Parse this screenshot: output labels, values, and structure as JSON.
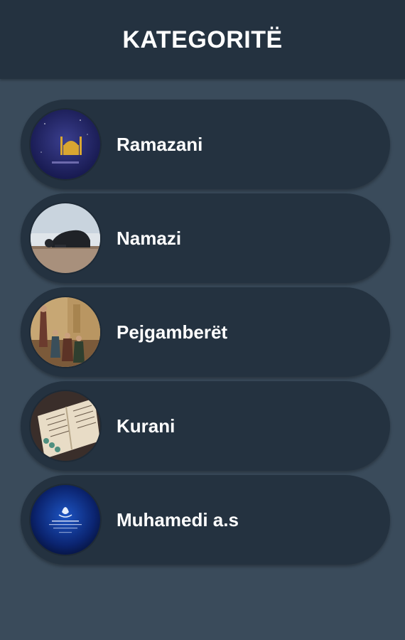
{
  "header": {
    "title": "KATEGORITË"
  },
  "categories": [
    {
      "label": "Ramazani",
      "image": "mosque-crescent-image"
    },
    {
      "label": "Namazi",
      "image": "prayer-prostration-image"
    },
    {
      "label": "Pejgamberët",
      "image": "prophets-painting-image"
    },
    {
      "label": "Kurani",
      "image": "quran-book-image"
    },
    {
      "label": "Muhamedi a.s",
      "image": "calligraphy-emblem-image"
    }
  ],
  "colors": {
    "background": "#3a4b5b",
    "header": "#243240",
    "card": "#243240",
    "text": "#ffffff"
  }
}
